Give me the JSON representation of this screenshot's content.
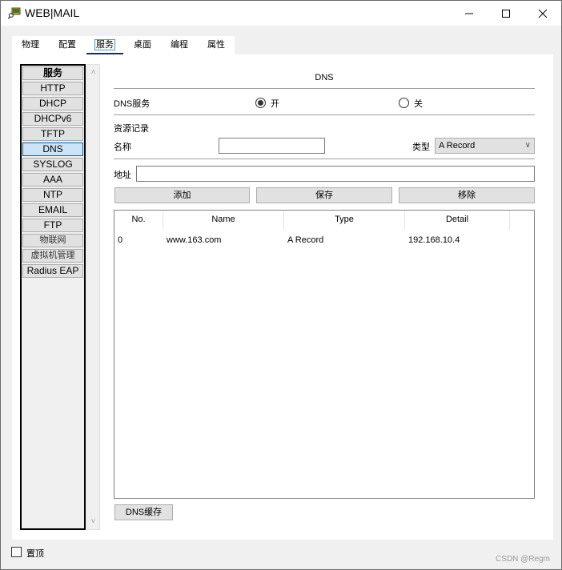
{
  "window": {
    "title": "WEB|MAIL",
    "icon": "packet-tracer-pc-icon",
    "controls": {
      "minimize": "minimize-icon",
      "maximize": "maximize-icon",
      "close": "close-icon"
    }
  },
  "tabs": [
    {
      "label": "物理",
      "active": false
    },
    {
      "label": "配置",
      "active": false
    },
    {
      "label": "服务",
      "active": true
    },
    {
      "label": "桌面",
      "active": false
    },
    {
      "label": "编程",
      "active": false
    },
    {
      "label": "属性",
      "active": false
    }
  ],
  "sidebar": {
    "header": "服务",
    "items": [
      {
        "label": "HTTP",
        "active": false
      },
      {
        "label": "DHCP",
        "active": false
      },
      {
        "label": "DHCPv6",
        "active": false
      },
      {
        "label": "TFTP",
        "active": false
      },
      {
        "label": "DNS",
        "active": true
      },
      {
        "label": "SYSLOG",
        "active": false
      },
      {
        "label": "AAA",
        "active": false
      },
      {
        "label": "NTP",
        "active": false
      },
      {
        "label": "EMAIL",
        "active": false
      },
      {
        "label": "FTP",
        "active": false
      },
      {
        "label": "物联网",
        "active": false
      },
      {
        "label": "虚拟机管理",
        "active": false
      },
      {
        "label": "Radius EAP",
        "active": false
      }
    ]
  },
  "dns": {
    "section_title": "DNS",
    "service_label": "DNS服务",
    "on_label": "开",
    "off_label": "关",
    "service_state": "on",
    "records_heading": "资源记录",
    "name_label": "名称",
    "name_value": "",
    "type_label": "类型",
    "type_value": "A Record",
    "address_label": "地址",
    "address_value": "",
    "buttons": {
      "add": "添加",
      "save": "保存",
      "remove": "移除",
      "cache": "DNS缓存"
    },
    "table": {
      "columns": [
        "No.",
        "Name",
        "Type",
        "Detail"
      ],
      "rows": [
        {
          "no": "0",
          "name": "www.163.com",
          "type": "A Record",
          "detail": "192.168.10.4"
        }
      ]
    }
  },
  "footer": {
    "pin_label": "置顶",
    "pin_checked": false,
    "watermark": "CSDN @Regm"
  }
}
